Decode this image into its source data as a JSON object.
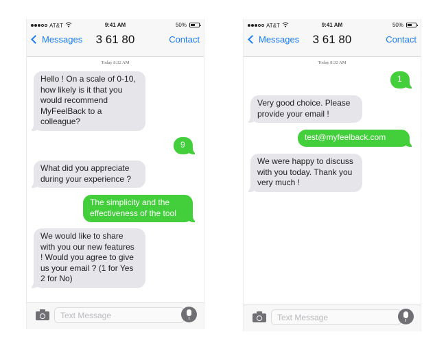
{
  "colors": {
    "accent": "#1a7cf5",
    "incoming_bubble": "#e5e5ea",
    "outgoing_bubble": "#43ce3b"
  },
  "phones": [
    {
      "status": {
        "carrier": "AT&T",
        "signal_bars": 3,
        "signal_total": 5,
        "time": "9:41 AM",
        "battery_text": "50%",
        "battery_level": 0.5
      },
      "nav": {
        "back_label": "Messages",
        "title": "3 61 80",
        "contact_label": "Contact"
      },
      "timestamp": "Today 8:32 AM",
      "messages": [
        {
          "direction": "incoming",
          "text": "Hello ! On a scale of 0-10, how likely is it that you would recommend MyFeelBack to a colleague?"
        },
        {
          "direction": "outgoing",
          "text": "9"
        },
        {
          "direction": "incoming",
          "text": "What did you appreciate during your experience ?"
        },
        {
          "direction": "outgoing",
          "text": "The simplicity and the effectiveness of the tool"
        },
        {
          "direction": "incoming",
          "text": "We would like to share with you our new features ! Would you agree to give us your email ? (1 for Yes 2 for No)"
        }
      ],
      "composer": {
        "placeholder": "Text Message",
        "left_icon": "camera-icon",
        "right_icon": "microphone-icon"
      }
    },
    {
      "status": {
        "carrier": "AT&T",
        "signal_bars": 3,
        "signal_total": 5,
        "time": "9:41 AM",
        "battery_text": "50%",
        "battery_level": 0.5
      },
      "nav": {
        "back_label": "Messages",
        "title": "3 61 80",
        "contact_label": "Contact"
      },
      "timestamp": "Today 8:32 AM",
      "messages": [
        {
          "direction": "outgoing",
          "text": "1"
        },
        {
          "direction": "incoming",
          "text": "Very good choice. Please provide your email !"
        },
        {
          "direction": "outgoing",
          "text": "test@myfeelback.com"
        },
        {
          "direction": "incoming",
          "text": "We were happy to discuss with you today. Thank you very much !"
        }
      ],
      "composer": {
        "placeholder": "Text Message",
        "left_icon": "camera-icon",
        "right_icon": "microphone-icon"
      }
    }
  ]
}
